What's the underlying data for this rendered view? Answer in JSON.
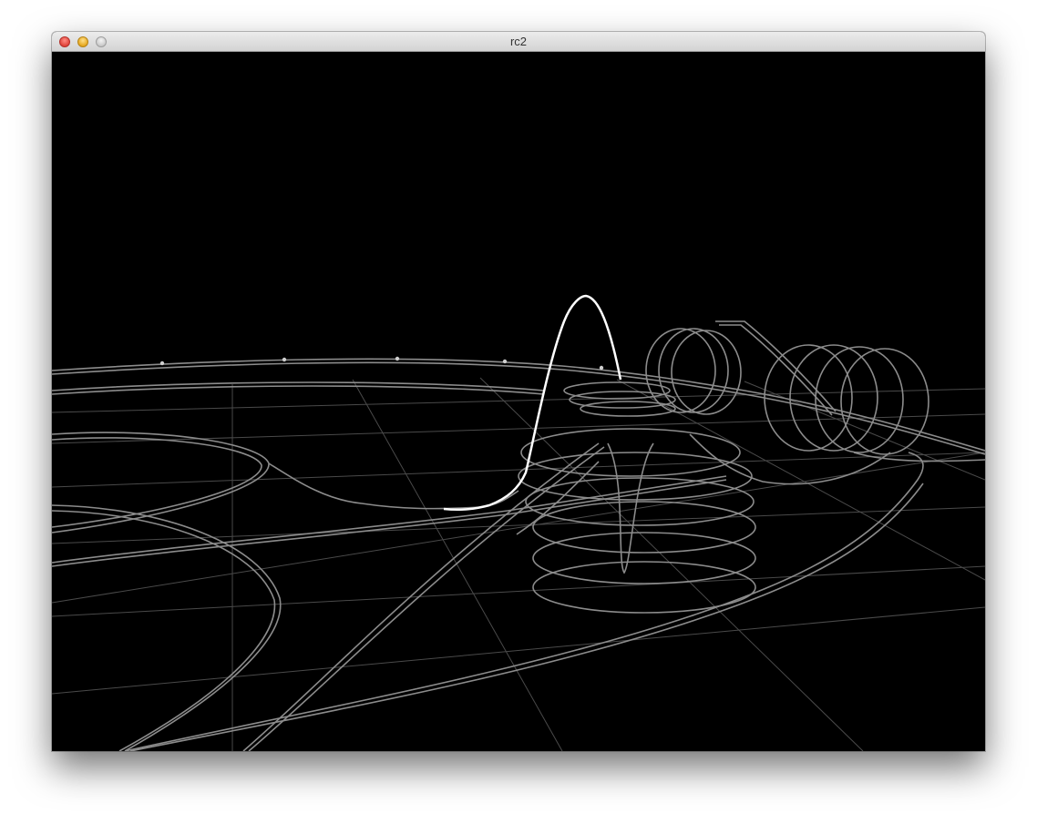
{
  "window": {
    "title": "rc2"
  },
  "controls": {
    "close_icon": "close-icon",
    "minimize_icon": "minimize-icon",
    "zoom_icon": "zoom-icon"
  },
  "scene": {
    "background": "#000000",
    "grid_color": "#4a4a4a",
    "track_color": "#8c8c8c",
    "highlight_color": "#ffffff"
  }
}
